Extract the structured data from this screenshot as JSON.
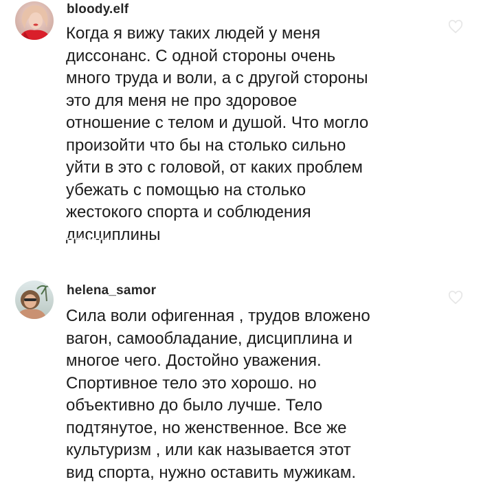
{
  "comments": [
    {
      "username": "bloody.elf",
      "text": "Когда я вижу таких людей у меня\nдиссонанс. С одной стороны очень\nмного труда и воли, а с другой стороны\nэто для меня не про здоровое\nотношение с телом и душой. Что могло\nпроизойти что бы на столько сильно\nуйти в это с головой, от каких проблем\nубежать с помощью на столько\nжестокого спорта и соблюдения\nдисциплины",
      "avatar_icon": "profile-photo-avatar"
    },
    {
      "username": "helena_samor",
      "text": "Сила воли офигенная , трудов вложено\nвагон, самообладание, дисциплина и\nмногое чего. Достойно уважения.\nСпортивное тело это хорошо. но\nобъективно до было лучше. Тело\nподтянутое, но женственное. Все же\nкультуризм , или как называется этот\nвид спорта, нужно оставить мужикам.",
      "avatar_icon": "profile-photo-avatar"
    }
  ],
  "colors": {
    "background": "#ffffff",
    "text": "#1c1c1c",
    "username": "#262626"
  }
}
